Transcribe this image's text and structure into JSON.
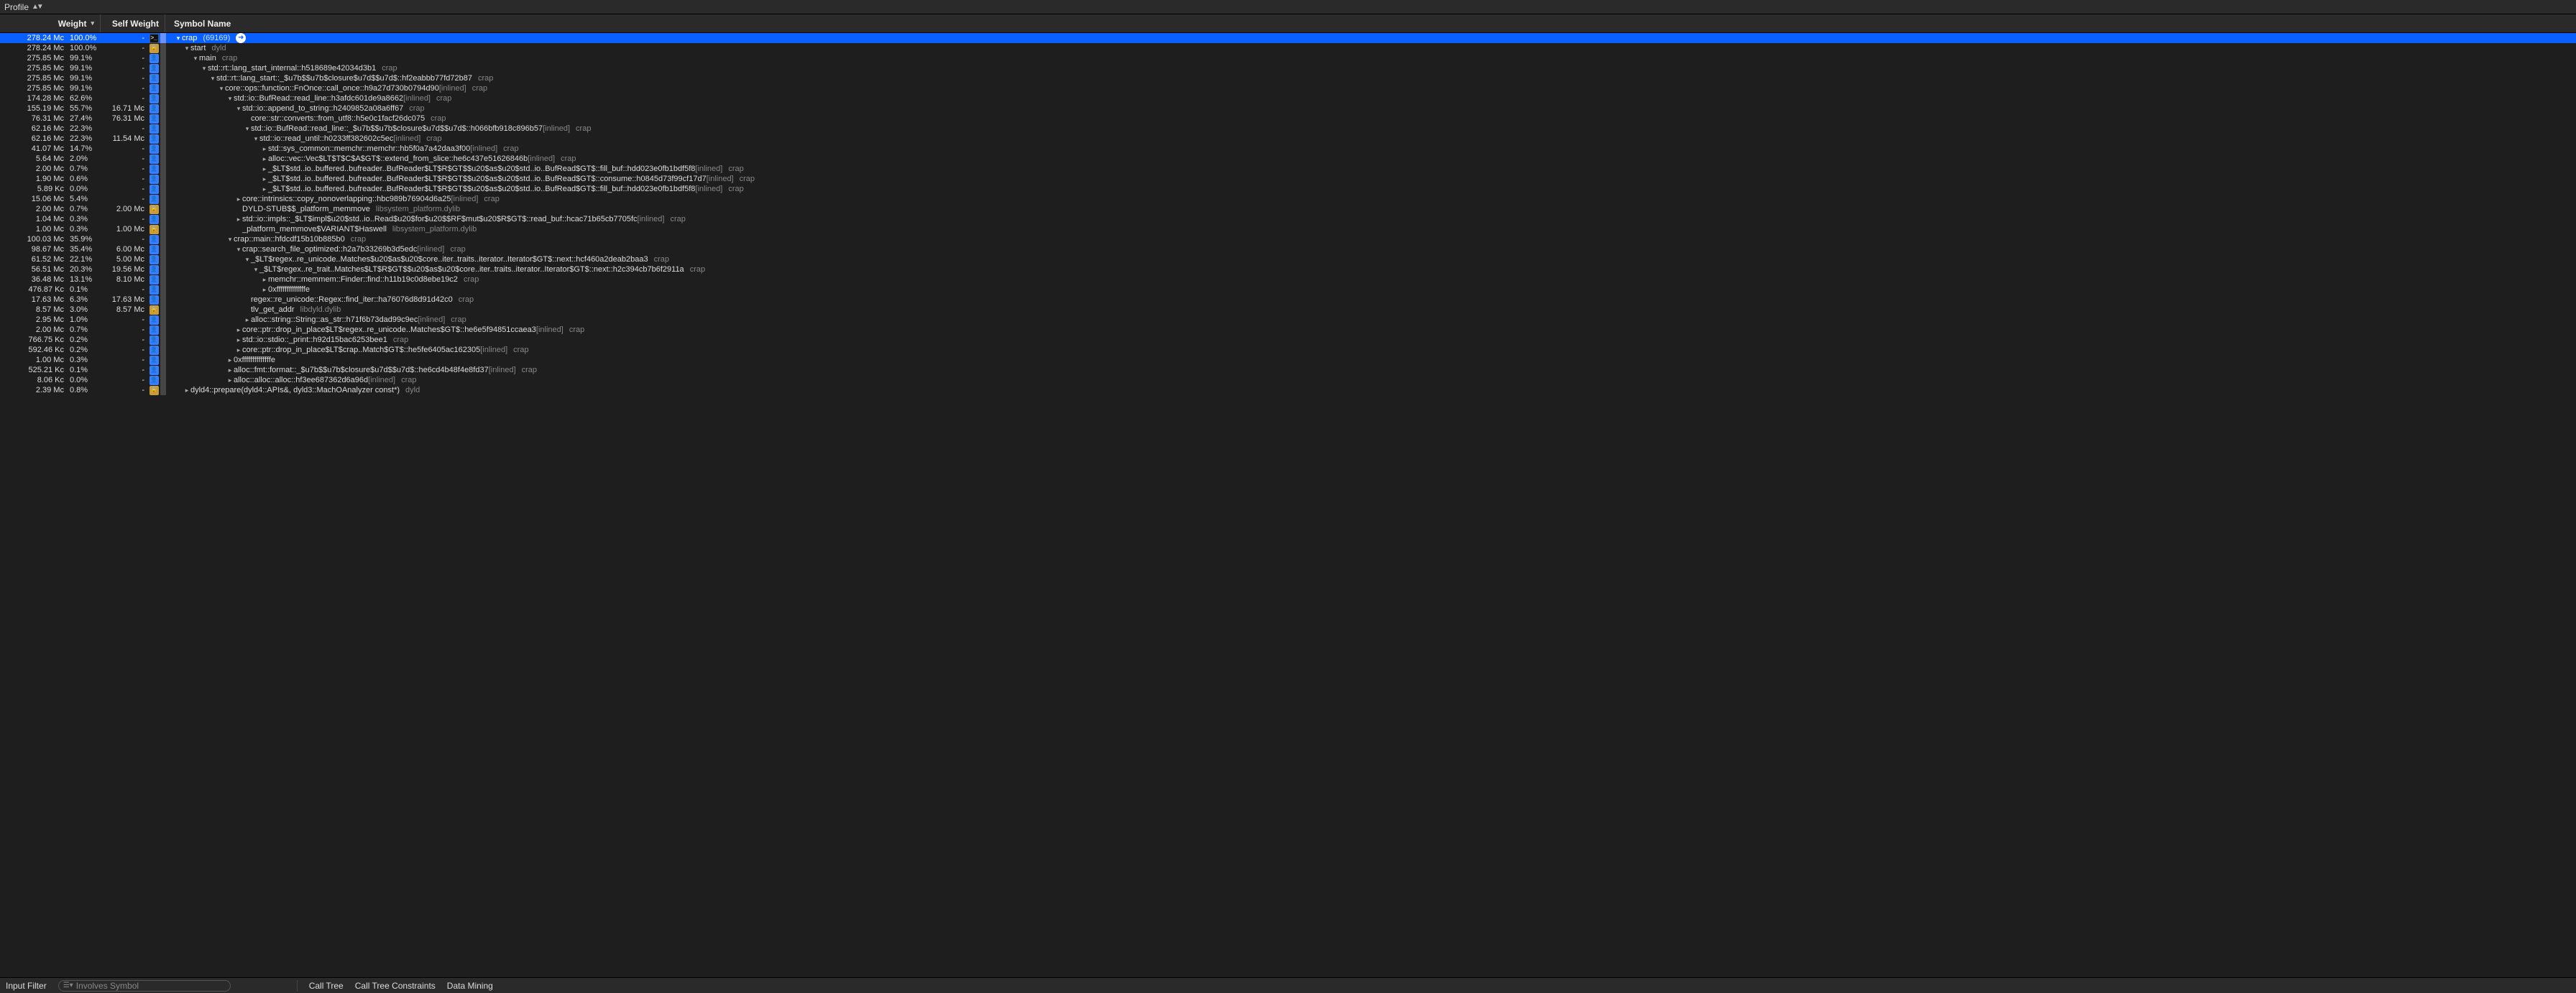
{
  "topbar": {
    "profile_label": "Profile"
  },
  "columns": {
    "weight": "Weight",
    "self": "Self Weight",
    "symbol": "Symbol Name"
  },
  "bottom": {
    "input_filter_label": "Input Filter",
    "involves_placeholder": "Involves Symbol",
    "call_tree": "Call Tree",
    "constraints": "Call Tree Constraints",
    "data_mining": "Data Mining"
  },
  "process_suffix": "(69169)",
  "rows": [
    {
      "w": "278.24 Mc",
      "p": "100.0%",
      "sw": "-",
      "ico": "term",
      "sel": true,
      "d": 1,
      "disc": "down",
      "name": "crap",
      "lib": "(69169)",
      "go": true
    },
    {
      "w": "278.24 Mc",
      "p": "100.0%",
      "sw": "-",
      "ico": "lock",
      "d": 2,
      "disc": "down",
      "name": "start",
      "lib": "dyld"
    },
    {
      "w": "275.85 Mc",
      "p": "99.1%",
      "sw": "-",
      "ico": "user",
      "d": 3,
      "disc": "down",
      "name": "main",
      "lib": "crap"
    },
    {
      "w": "275.85 Mc",
      "p": "99.1%",
      "sw": "-",
      "ico": "user",
      "d": 4,
      "disc": "down",
      "name": "std::rt::lang_start_internal::h518689e42034d3b1",
      "lib": "crap"
    },
    {
      "w": "275.85 Mc",
      "p": "99.1%",
      "sw": "-",
      "ico": "user",
      "d": 5,
      "disc": "down",
      "name": "std::rt::lang_start::_$u7b$$u7b$closure$u7d$$u7d$::hf2eabbb77fd72b87",
      "lib": "crap"
    },
    {
      "w": "275.85 Mc",
      "p": "99.1%",
      "sw": "-",
      "ico": "user",
      "d": 6,
      "disc": "down",
      "name": "core::ops::function::FnOnce::call_once::h9a27d730b0794d90 [inlined]",
      "lib": "crap"
    },
    {
      "w": "174.28 Mc",
      "p": "62.6%",
      "sw": "-",
      "ico": "user",
      "d": 7,
      "disc": "down",
      "name": "std::io::BufRead::read_line::h3afdc601de9a8662 [inlined]",
      "lib": "crap"
    },
    {
      "w": "155.19 Mc",
      "p": "55.7%",
      "sw": "16.71 Mc",
      "ico": "user",
      "d": 8,
      "disc": "down",
      "name": "std::io::append_to_string::h2409852a08a6ff67",
      "lib": "crap"
    },
    {
      "w": "76.31 Mc",
      "p": "27.4%",
      "sw": "76.31 Mc",
      "ico": "user",
      "d": 9,
      "disc": "",
      "name": "core::str::converts::from_utf8::h5e0c1facf26dc075",
      "lib": "crap"
    },
    {
      "w": "62.16 Mc",
      "p": "22.3%",
      "sw": "-",
      "ico": "user",
      "d": 9,
      "disc": "down",
      "name": "std::io::BufRead::read_line::_$u7b$$u7b$closure$u7d$$u7d$::h066bfb918c896b57 [inlined]",
      "lib": "crap"
    },
    {
      "w": "62.16 Mc",
      "p": "22.3%",
      "sw": "11.54 Mc",
      "ico": "user",
      "d": 10,
      "disc": "down",
      "name": "std::io::read_until::h0233ff382602c5ec [inlined]",
      "lib": "crap"
    },
    {
      "w": "41.07 Mc",
      "p": "14.7%",
      "sw": "-",
      "ico": "user",
      "d": 11,
      "disc": "right",
      "name": "std::sys_common::memchr::memchr::hb5f0a7a42daa3f00 [inlined]",
      "lib": "crap"
    },
    {
      "w": "5.64 Mc",
      "p": "2.0%",
      "sw": "-",
      "ico": "user",
      "d": 11,
      "disc": "right",
      "name": "alloc::vec::Vec$LT$T$C$A$GT$::extend_from_slice::he6c437e51626846b [inlined]",
      "lib": "crap"
    },
    {
      "w": "2.00 Mc",
      "p": "0.7%",
      "sw": "-",
      "ico": "user",
      "d": 11,
      "disc": "right",
      "name": "_$LT$std..io..buffered..bufreader..BufReader$LT$R$GT$$u20$as$u20$std..io..BufRead$GT$::fill_buf::hdd023e0fb1bdf5f8 [inlined]",
      "lib": "crap"
    },
    {
      "w": "1.90 Mc",
      "p": "0.6%",
      "sw": "-",
      "ico": "user",
      "d": 11,
      "disc": "right",
      "name": "_$LT$std..io..buffered..bufreader..BufReader$LT$R$GT$$u20$as$u20$std..io..BufRead$GT$::consume::h0845d73f99cf17d7 [inlined]",
      "lib": "crap"
    },
    {
      "w": "5.89 Kc",
      "p": "0.0%",
      "sw": "-",
      "ico": "user",
      "d": 11,
      "disc": "right",
      "name": "_$LT$std..io..buffered..bufreader..BufReader$LT$R$GT$$u20$as$u20$std..io..BufRead$GT$::fill_buf::hdd023e0fb1bdf5f8 [inlined]",
      "lib": "crap"
    },
    {
      "w": "15.06 Mc",
      "p": "5.4%",
      "sw": "-",
      "ico": "user",
      "d": 8,
      "disc": "right",
      "name": "core::intrinsics::copy_nonoverlapping::hbc989b76904d6a25 [inlined]",
      "lib": "crap"
    },
    {
      "w": "2.00 Mc",
      "p": "0.7%",
      "sw": "2.00 Mc",
      "ico": "lock",
      "d": 8,
      "disc": "",
      "name": "DYLD-STUB$$_platform_memmove",
      "lib": "libsystem_platform.dylib"
    },
    {
      "w": "1.04 Mc",
      "p": "0.3%",
      "sw": "-",
      "ico": "user",
      "d": 8,
      "disc": "right",
      "name": "std::io::impls::_$LT$impl$u20$std..io..Read$u20$for$u20$$RF$mut$u20$R$GT$::read_buf::hcac71b65cb7705fc [inlined]",
      "lib": "crap"
    },
    {
      "w": "1.00 Mc",
      "p": "0.3%",
      "sw": "1.00 Mc",
      "ico": "lock",
      "d": 8,
      "disc": "",
      "name": "_platform_memmove$VARIANT$Haswell",
      "lib": "libsystem_platform.dylib"
    },
    {
      "w": "100.03 Mc",
      "p": "35.9%",
      "sw": "-",
      "ico": "user",
      "d": 7,
      "disc": "down",
      "name": "crap::main::hfdcdf15b10b885b0",
      "lib": "crap"
    },
    {
      "w": "98.67 Mc",
      "p": "35.4%",
      "sw": "6.00 Mc",
      "ico": "user",
      "d": 8,
      "disc": "down",
      "name": "crap::search_file_optimized::h2a7b33269b3d5edc [inlined]",
      "lib": "crap"
    },
    {
      "w": "61.52 Mc",
      "p": "22.1%",
      "sw": "5.00 Mc",
      "ico": "user",
      "d": 9,
      "disc": "down",
      "name": "_$LT$regex..re_unicode..Matches$u20$as$u20$core..iter..traits..iterator..Iterator$GT$::next::hcf460a2deab2baa3",
      "lib": "crap"
    },
    {
      "w": "56.51 Mc",
      "p": "20.3%",
      "sw": "19.56 Mc",
      "ico": "user",
      "d": 10,
      "disc": "down",
      "name": "_$LT$regex..re_trait..Matches$LT$R$GT$$u20$as$u20$core..iter..traits..iterator..Iterator$GT$::next::h2c394cb7b6f2911a",
      "lib": "crap"
    },
    {
      "w": "36.48 Mc",
      "p": "13.1%",
      "sw": "8.10 Mc",
      "ico": "user",
      "d": 11,
      "disc": "right",
      "name": "memchr::memmem::Finder::find::h11b19c0d8ebe19c2",
      "lib": "crap"
    },
    {
      "w": "476.87 Kc",
      "p": "0.1%",
      "sw": "-",
      "ico": "user",
      "d": 11,
      "disc": "right",
      "name": "0xffffffffffffffe",
      "lib": ""
    },
    {
      "w": "17.63 Mc",
      "p": "6.3%",
      "sw": "17.63 Mc",
      "ico": "user",
      "d": 9,
      "disc": "",
      "name": "regex::re_unicode::Regex::find_iter::ha76076d8d91d42c0",
      "lib": "crap"
    },
    {
      "w": "8.57 Mc",
      "p": "3.0%",
      "sw": "8.57 Mc",
      "ico": "lock",
      "d": 9,
      "disc": "",
      "name": "tlv_get_addr",
      "lib": "libdyld.dylib"
    },
    {
      "w": "2.95 Mc",
      "p": "1.0%",
      "sw": "-",
      "ico": "user",
      "d": 9,
      "disc": "right",
      "name": "alloc::string::String::as_str::h71f6b73dad99c9ec [inlined]",
      "lib": "crap"
    },
    {
      "w": "2.00 Mc",
      "p": "0.7%",
      "sw": "-",
      "ico": "user",
      "d": 8,
      "disc": "right",
      "name": "core::ptr::drop_in_place$LT$regex..re_unicode..Matches$GT$::he6e5f94851ccaea3 [inlined]",
      "lib": "crap"
    },
    {
      "w": "766.75 Kc",
      "p": "0.2%",
      "sw": "-",
      "ico": "user",
      "d": 8,
      "disc": "right",
      "name": "std::io::stdio::_print::h92d15bac6253bee1",
      "lib": "crap"
    },
    {
      "w": "592.46 Kc",
      "p": "0.2%",
      "sw": "-",
      "ico": "user",
      "d": 8,
      "disc": "right",
      "name": "core::ptr::drop_in_place$LT$crap..Match$GT$::he5fe6405ac162305 [inlined]",
      "lib": "crap"
    },
    {
      "w": "1.00 Mc",
      "p": "0.3%",
      "sw": "-",
      "ico": "user",
      "d": 7,
      "disc": "right",
      "name": "0xffffffffffffffe",
      "lib": ""
    },
    {
      "w": "525.21 Kc",
      "p": "0.1%",
      "sw": "-",
      "ico": "user",
      "d": 7,
      "disc": "right",
      "name": "alloc::fmt::format::_$u7b$$u7b$closure$u7d$$u7d$::he6cd4b48f4e8fd37 [inlined]",
      "lib": "crap"
    },
    {
      "w": "8.06 Kc",
      "p": "0.0%",
      "sw": "-",
      "ico": "user",
      "d": 7,
      "disc": "right",
      "name": "alloc::alloc::alloc::hf3ee687362d6a96d [inlined]",
      "lib": "crap"
    },
    {
      "w": "2.39 Mc",
      "p": "0.8%",
      "sw": "-",
      "ico": "lock",
      "d": 2,
      "disc": "right",
      "name": "dyld4::prepare(dyld4::APIs&, dyld3::MachOAnalyzer const*)",
      "lib": "dyld"
    }
  ]
}
